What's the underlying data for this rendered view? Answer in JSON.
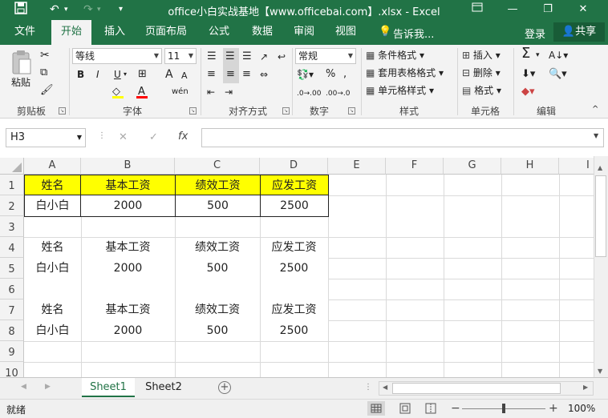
{
  "titlebar": {
    "title": "office小白实战基地【www.officebai.com】.xlsx - Excel",
    "bg_color": "#217346"
  },
  "tabs": [
    "文件",
    "开始",
    "插入",
    "页面布局",
    "公式",
    "数据",
    "审阅",
    "视图"
  ],
  "tell_me": "告诉我...",
  "login": "登录",
  "share": "共享",
  "ribbon": {
    "clipboard": {
      "paste": "粘贴",
      "label": "剪贴板"
    },
    "font": {
      "name": "等线",
      "size": "11",
      "label": "字体",
      "bold": "B",
      "italic": "I",
      "underline": "U",
      "grow": "A",
      "shrink": "A"
    },
    "alignment": {
      "label": "对齐方式"
    },
    "number": {
      "format": "常规",
      "label": "数字",
      "percent": "%"
    },
    "styles": {
      "conditional": "条件格式",
      "table": "套用表格格式",
      "cell": "单元格样式",
      "label": "样式"
    },
    "cells": {
      "insert": "插入",
      "delete": "删除",
      "format": "格式",
      "label": "单元格"
    },
    "editing": {
      "label": "编辑"
    }
  },
  "name_box": "H3",
  "fx": "fx",
  "columns": [
    "A",
    "B",
    "C",
    "D",
    "E",
    "F",
    "G",
    "H",
    "I"
  ],
  "rows": [
    "1",
    "2",
    "3",
    "4",
    "5",
    "6",
    "7",
    "8",
    "9",
    "10"
  ],
  "table1": {
    "headers": [
      "姓名",
      "基本工资",
      "绩效工资",
      "应发工资"
    ],
    "values": [
      "白小白",
      "2000",
      "500",
      "2500"
    ],
    "header_fill": "#ffff00"
  },
  "table2": {
    "headers": [
      "姓名",
      "基本工资",
      "绩效工资",
      "应发工资"
    ],
    "values": [
      "白小白",
      "2000",
      "500",
      "2500"
    ]
  },
  "table3": {
    "headers": [
      "姓名",
      "基本工资",
      "绩效工资",
      "应发工资"
    ],
    "values": [
      "白小白",
      "2000",
      "500",
      "2500"
    ]
  },
  "sheets": [
    "Sheet1",
    "Sheet2"
  ],
  "status": {
    "ready": "就绪",
    "zoom": "100%"
  }
}
